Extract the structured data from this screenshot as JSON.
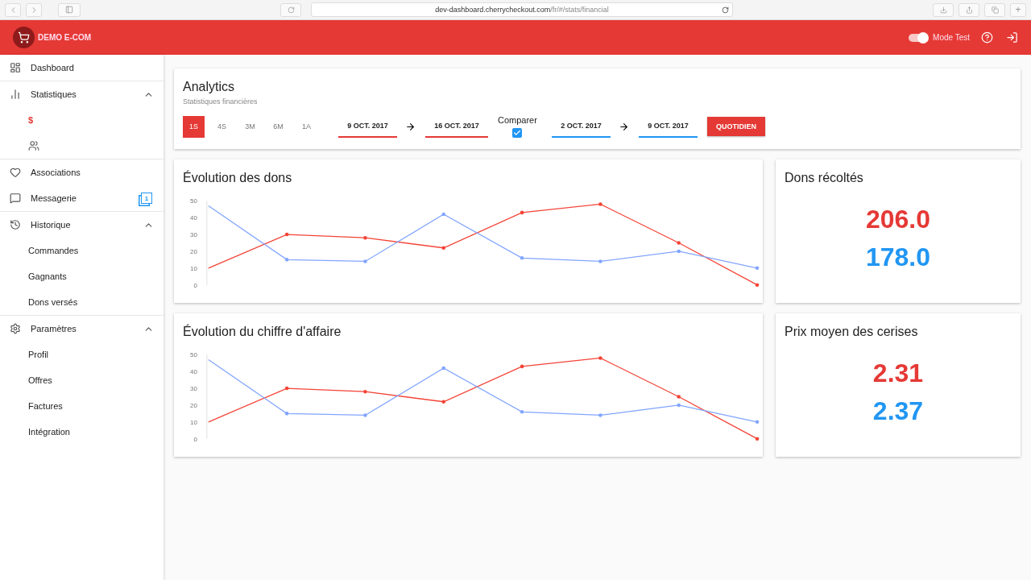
{
  "browser": {
    "url_host": "dev-dashboard.cherrycheckout.com",
    "url_path": "/fr/#/stats/financial",
    "new_tab": "+"
  },
  "header": {
    "brand": "DEMO E-COM",
    "mode_test": {
      "label": "Mode Test",
      "on": true
    }
  },
  "sidebar": {
    "items": [
      {
        "label": "Dashboard",
        "divider": true
      },
      {
        "label": "Statistiques",
        "expanded": true,
        "divider": true,
        "children": [
          {
            "label": "$",
            "selected": true
          },
          {
            "selected": false
          }
        ]
      },
      {
        "label": "Associations"
      },
      {
        "label": "Messagerie",
        "badge": "1",
        "divider": true
      },
      {
        "label": "Historique",
        "expanded": true,
        "divider": true,
        "children": [
          {
            "label": "Commandes",
            "selected": false
          },
          {
            "label": "Gagnants",
            "selected": false
          },
          {
            "label": "Dons versés",
            "selected": false
          }
        ]
      },
      {
        "label": "Paramètres",
        "expanded": true,
        "children": [
          {
            "label": "Profil",
            "selected": false
          },
          {
            "label": "Offres",
            "selected": false
          },
          {
            "label": "Factures",
            "selected": false
          },
          {
            "label": "Intégration",
            "selected": false
          }
        ]
      }
    ]
  },
  "analytics": {
    "title": "Analytics",
    "subtitle": "Statistiques financières",
    "periods": [
      {
        "label": "1S",
        "selected": true
      },
      {
        "label": "4S",
        "selected": false
      },
      {
        "label": "3M",
        "selected": false
      },
      {
        "label": "6M",
        "selected": false
      },
      {
        "label": "1A",
        "selected": false
      }
    ],
    "range": {
      "color": "#e53935",
      "from": "9 OCT. 2017",
      "to": "16 OCT. 2017"
    },
    "compare": {
      "label": "Comparer",
      "checked": true
    },
    "compare_range": {
      "color": "#2196f3",
      "from": "2 OCT. 2017",
      "to": "9 OCT. 2017"
    },
    "granularity_button": "QUOTIDIEN"
  },
  "rows": [
    {
      "chart": {
        "title": "Évolution des dons",
        "chart_data": {
          "type": "line",
          "ylim": [
            0,
            50
          ],
          "yticks": [
            0,
            10,
            20,
            30,
            40,
            50
          ],
          "series": [
            {
              "color": "#f44336",
              "values": [
                10,
                30,
                28,
                22,
                43,
                48,
                25,
                0
              ]
            },
            {
              "color": "#82a5ff",
              "values": [
                47,
                15,
                14,
                42,
                16,
                14,
                20,
                10
              ]
            }
          ]
        }
      },
      "stat": {
        "title": "Dons récoltés",
        "values": [
          {
            "text": "206.0",
            "color": "#e53935"
          },
          {
            "text": "178.0",
            "color": "#2196f3"
          }
        ]
      }
    },
    {
      "chart": {
        "title": "Évolution du chiffre d'affaire",
        "chart_data": {
          "type": "line",
          "ylim": [
            0,
            50
          ],
          "yticks": [
            0,
            10,
            20,
            30,
            40,
            50
          ],
          "series": [
            {
              "color": "#f44336",
              "values": [
                10,
                30,
                28,
                22,
                43,
                48,
                25,
                0
              ]
            },
            {
              "color": "#82a5ff",
              "values": [
                47,
                15,
                14,
                42,
                16,
                14,
                20,
                10
              ]
            }
          ]
        }
      },
      "stat": {
        "title": "Prix moyen des cerises",
        "values": [
          {
            "text": "2.31",
            "color": "#e53935"
          },
          {
            "text": "2.37",
            "color": "#2196f3"
          }
        ]
      }
    }
  ]
}
